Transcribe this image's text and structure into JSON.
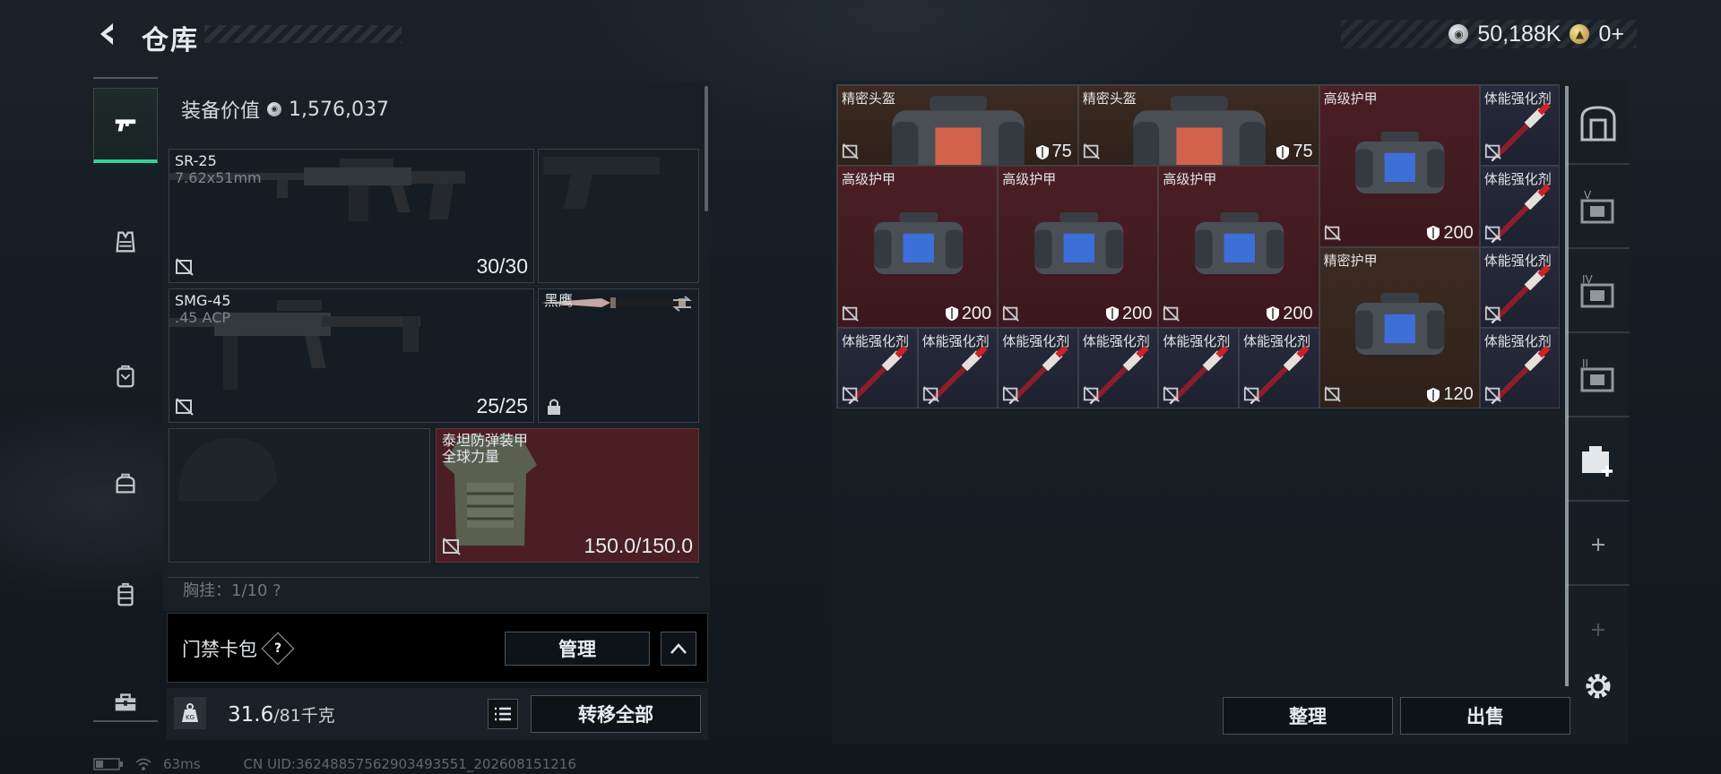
{
  "header": {
    "title": "仓库",
    "currency_silver": "50,188K",
    "currency_gold": "0+"
  },
  "tabs": [
    {
      "icon": "pistol-icon",
      "active": true
    },
    {
      "icon": "vest-icon",
      "active": false
    },
    {
      "icon": "backpack-icon",
      "active": false
    },
    {
      "icon": "bag-icon",
      "active": false
    },
    {
      "icon": "case-icon",
      "active": false
    },
    {
      "icon": "toolbox-icon",
      "active": false
    }
  ],
  "loadout": {
    "equip_value_label": "装备价值",
    "equip_value": "1,576,037",
    "primary": {
      "name": "SR-25",
      "caliber": "7.62x51mm",
      "ammo": "30/30"
    },
    "secondary": {
      "name": "SMG-45",
      "caliber": ".45 ACP",
      "ammo": "25/25"
    },
    "melee": {
      "name": "黑鹰"
    },
    "armor": {
      "name": "泰坦防弹装甲",
      "sub": "全球力量",
      "durability": "150.0/150.0"
    },
    "pockets": "胸挂：1/10 ?"
  },
  "card_bag": {
    "label": "门禁卡包",
    "help": "?",
    "manage": "管理"
  },
  "weight": {
    "current": "31.6",
    "max": "/81千克",
    "transfer_all": "转移全部"
  },
  "status": {
    "ping": "63ms",
    "uid": "CN UID:36248857562903493551_202608151216"
  },
  "stash": {
    "items": [
      {
        "name": "精密头盔",
        "dur": "75",
        "type": "helmet",
        "color": "brown"
      },
      {
        "name": "精密头盔",
        "dur": "75",
        "type": "helmet",
        "color": "brown"
      },
      {
        "name": "高级护甲",
        "dur": "200",
        "type": "armor",
        "color": "red"
      },
      {
        "name": "体能强化剂",
        "dur": "",
        "type": "syringe",
        "color": "purple"
      },
      {
        "name": "体能强化剂",
        "dur": "",
        "type": "syringe",
        "color": "purple"
      },
      {
        "name": "高级护甲",
        "dur": "200",
        "type": "armor",
        "color": "red"
      },
      {
        "name": "高级护甲",
        "dur": "200",
        "type": "armor",
        "color": "red"
      },
      {
        "name": "高级护甲",
        "dur": "200",
        "type": "armor",
        "color": "red"
      },
      {
        "name": "精密护甲",
        "dur": "120",
        "type": "armor",
        "color": "brown"
      },
      {
        "name": "体能强化剂",
        "dur": "",
        "type": "syringe",
        "color": "purple"
      },
      {
        "name": "体能强化剂",
        "dur": "",
        "type": "syringe",
        "color": "purple"
      },
      {
        "name": "体能强化剂",
        "dur": "",
        "type": "syringe",
        "color": "purple"
      },
      {
        "name": "体能强化剂",
        "dur": "",
        "type": "syringe",
        "color": "purple"
      },
      {
        "name": "体能强化剂",
        "dur": "",
        "type": "syringe",
        "color": "purple"
      },
      {
        "name": "体能强化剂",
        "dur": "",
        "type": "syringe",
        "color": "purple"
      },
      {
        "name": "体能强化剂",
        "dur": "",
        "type": "syringe",
        "color": "purple"
      },
      {
        "name": "体能强化剂",
        "dur": "",
        "type": "syringe",
        "color": "purple"
      }
    ],
    "sort_button": "整理",
    "sell_button": "出售"
  },
  "side_nav": [
    {
      "icon": "safe-box-icon"
    },
    {
      "icon": "case-v-icon",
      "label": "V"
    },
    {
      "icon": "case-iv-icon",
      "label": "IV"
    },
    {
      "icon": "case-ii-icon",
      "label": "II"
    },
    {
      "icon": "medkit-case-icon"
    },
    {
      "icon": "add-icon",
      "label": "+"
    },
    {
      "icon": "add-icon",
      "label": "+"
    }
  ],
  "colors": {
    "accent": "#2fd39a",
    "slot_red": "#4a1e22",
    "slot_brown": "#3c2b22",
    "slot_purple": "#262a3a"
  }
}
